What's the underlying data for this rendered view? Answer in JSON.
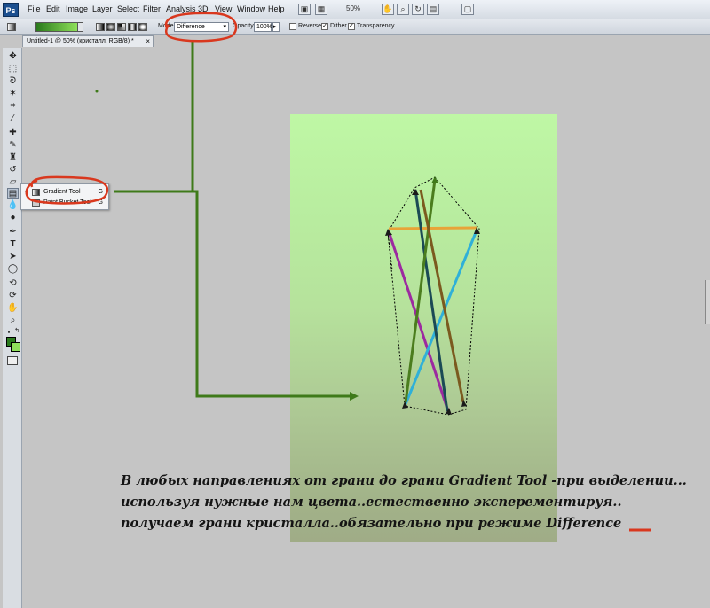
{
  "app": {
    "logo": "Ps"
  },
  "menubar": {
    "items": [
      "File",
      "Edit",
      "Image",
      "Layer",
      "Select",
      "Filter",
      "Analysis",
      "3D",
      "View",
      "Window",
      "Help"
    ],
    "zoom": "50%"
  },
  "options": {
    "mode_label": "Mode:",
    "mode_value": "Difference",
    "opacity_label": "Opacity:",
    "opacity_value": "100%",
    "reverse_label": "Reverse",
    "dither_label": "Dither",
    "transparency_label": "Transparency",
    "checkmark": "✓"
  },
  "document": {
    "tab_title": "Untitled-1 @ 50% (кристалл, RGB/8) *",
    "close": "×"
  },
  "tools": {
    "icons": [
      "move-icon",
      "marquee-icon",
      "lasso-icon",
      "magic-wand-icon",
      "crop-icon",
      "eyedropper-icon",
      "healing-brush-icon",
      "brush-icon",
      "clone-stamp-icon",
      "history-brush-icon",
      "eraser-icon",
      "gradient-icon",
      "blur-icon",
      "dodge-icon",
      "pen-icon",
      "type-icon",
      "path-selection-icon",
      "shape-icon",
      "3d-rotate-icon",
      "3d-orbit-icon",
      "hand-icon",
      "zoom-icon"
    ]
  },
  "flyout": {
    "items": [
      {
        "label": "Gradient Tool",
        "key": "G"
      },
      {
        "label": "Paint Bucket Tool",
        "key": "G"
      }
    ]
  },
  "caption": {
    "line1": "В любых направлениях  от грани до грани Gradient Tool -при выделении...",
    "line2": "используя нужные нам цвета..естественно эксперементируя..",
    "line3": "получаем грани кристалла..обязательно при режиме Difference"
  },
  "colors": {
    "annotation_red": "#d9381e",
    "annotation_green": "#3f7a1a",
    "foreground": "#2a7a1c",
    "background": "#8fe05a"
  }
}
